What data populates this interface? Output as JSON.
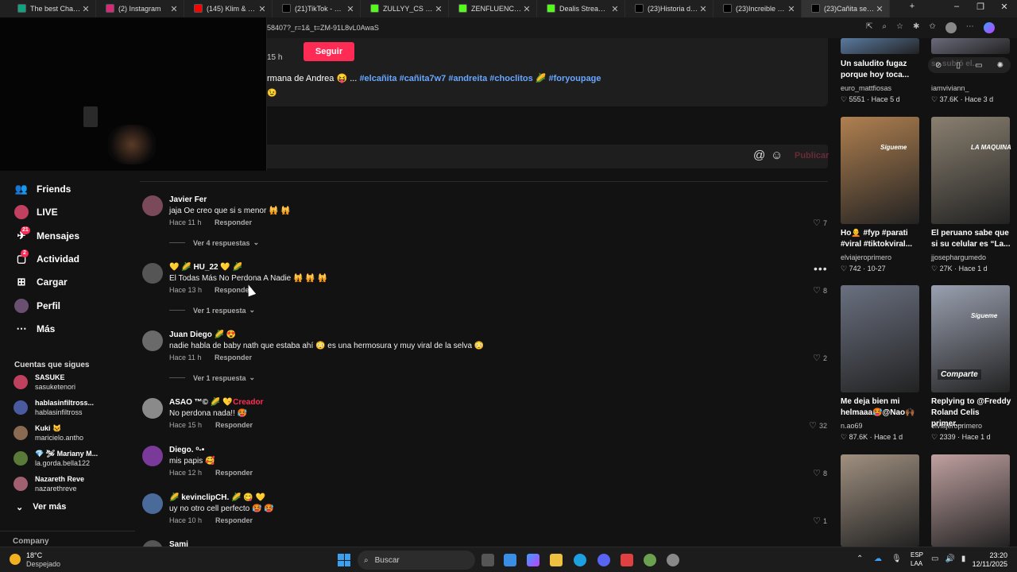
{
  "browser": {
    "tabs": [
      {
        "label": "The best ChatBot ai",
        "icon_color": "#10a37f",
        "icon": "chatbot-icon"
      },
      {
        "label": "(2) Instagram",
        "icon_color": "#d62976",
        "icon": "instagram-icon"
      },
      {
        "label": "(145) Klim & ZULLY",
        "icon_color": "#ff0000",
        "icon": "youtube-icon"
      },
      {
        "label": "(21)TikTok - Make Y",
        "icon_color": "#000000",
        "icon": "tiktok-icon"
      },
      {
        "label": "ZULLYY_CS Stream",
        "icon_color": "#53fc18",
        "icon": "kick-icon"
      },
      {
        "label": "ZENFLUENCER Stre",
        "icon_color": "#53fc18",
        "icon": "kick-icon"
      },
      {
        "label": "Dealis Stream - W",
        "icon_color": "#53fc18",
        "icon": "kick-icon"
      },
      {
        "label": "(23)Historia de Ma",
        "icon_color": "#000000",
        "icon": "tiktok-icon"
      },
      {
        "label": "(23)Increible pero s",
        "icon_color": "#000000",
        "icon": "tiktok-icon"
      },
      {
        "label": "(23)Cañita se encu",
        "icon_color": "#000000",
        "icon": "tiktok-icon",
        "active": true
      }
    ],
    "url": "58407?_r=1&_t=ZM-91L8vL0AwaS"
  },
  "video_panel": {
    "time_fragment": "15 h",
    "follow_label": "Seguir",
    "caption_prefix": "rmana de Andrea 😝 ... ",
    "hashtags": "#elcañita #cañita7w7 #andreita #choclitos 🌽 #foryoupage",
    "second_line": "😉",
    "post_label": "Publicar"
  },
  "sidebar": {
    "items": [
      {
        "label": "Friends",
        "icon": "friends-icon"
      },
      {
        "label": "LIVE",
        "icon": "live-icon"
      },
      {
        "label": "Mensajes",
        "icon": "messages-icon",
        "badge": "21"
      },
      {
        "label": "Actividad",
        "icon": "activity-icon",
        "badge": "2"
      },
      {
        "label": "Cargar",
        "icon": "upload-icon"
      },
      {
        "label": "Perfil",
        "icon": "profile-icon"
      },
      {
        "label": "Más",
        "icon": "more-icon"
      }
    ],
    "following_title": "Cuentas que sigues",
    "following": [
      {
        "name": "SASUKE",
        "handle": "sasuketenori",
        "color": "#c04060"
      },
      {
        "name": "hablasinfiltross...",
        "handle": "hablasinfiltross",
        "color": "#4a5aa0"
      },
      {
        "name": "Kuki 🐱",
        "handle": "maricielo.antho",
        "color": "#8a6a50"
      },
      {
        "name": "💎 🛩 Mariany M...",
        "handle": "la.gorda.bella122",
        "color": "#5a7a3a"
      },
      {
        "name": "Nazareth Reve",
        "handle": "nazarethreve",
        "color": "#a06070"
      }
    ],
    "see_more": "Ver más",
    "company": "Company"
  },
  "comments": [
    {
      "name": "Javier Fer",
      "text": "jaja Oe creo que si s menor 🙀 🙀",
      "time": "Hace 11 h",
      "reply": "Responder",
      "likes": "7",
      "replies": "Ver 4 respuestas",
      "avatar_color": "#7a4a5a"
    },
    {
      "name": "💛 🌽 HU_22 💛 🌽",
      "text": "El Todas Más No Perdona A Nadie 🙀 🙀 🙀",
      "time": "Hace 13 h",
      "reply": "Responder",
      "likes": "8",
      "replies": "Ver 1 respuesta",
      "avatar_color": "#555555"
    },
    {
      "name": "Juan Diego 🌽 😍",
      "text": "nadie habla de baby nath que estaba ahí 😳 es una hermosura y muy viral de la selva 😳",
      "time": "Hace 11 h",
      "reply": "Responder",
      "likes": "2",
      "replies": "Ver 1 respuesta",
      "avatar_color": "#6a6a6a"
    },
    {
      "name": "ASAO ™©  🌽 💛",
      "creator": "· Creador",
      "text": "No perdona nada!! 🥵",
      "time": "Hace 15 h",
      "reply": "Responder",
      "likes": "32",
      "avatar_color": "#8a8a8a"
    },
    {
      "name": "Diego. ᵒ-•",
      "text": "mis papis 🥰",
      "time": "Hace 12 h",
      "reply": "Responder",
      "likes": "8",
      "avatar_color": "#7a3a9a"
    },
    {
      "name": "🌽 kevinclipCH. 🌽 😋 💛",
      "text": "uy no otro cell perfecto 🥵 🥵",
      "time": "Hace 10 h",
      "reply": "Responder",
      "likes": "1",
      "avatar_color": "#4a6a9a"
    },
    {
      "name": "Sami",
      "text": "",
      "time": "",
      "reply": "",
      "likes": "",
      "avatar_color": "#555555"
    }
  ],
  "videos": [
    {
      "title": "Un saludito fugaz porque hoy toca...",
      "user": "euro_mattfiosas",
      "likes": "5551",
      "date": "Hace 5 d",
      "color": "#5a7aa0"
    },
    {
      "title": "se subió el...",
      "user": "iamviviann_",
      "likes": "37.6K",
      "date": "Hace 3 d",
      "color": "#6a6a7a"
    },
    {
      "title": "Ho🧑‍🦲 #fyp #parati #viral #tiktokviral...",
      "user": "elviajeroprimero",
      "likes": "742",
      "date": "10-27",
      "color": "#b08050",
      "tag": "Sígueme"
    },
    {
      "title": "El peruano sabe que si su celular es “La...",
      "user": "jjosephargumedo",
      "likes": "27K",
      "date": "Hace 1 d",
      "color": "#8a8070",
      "tag": "LA MAQUINA"
    },
    {
      "title": "Me deja bien mi helmaaa🥵@Nao🙌🏾",
      "user": "n.ao69",
      "likes": "87.6K",
      "date": "Hace 1 d",
      "color": "#6a7080"
    },
    {
      "title": "Replying to @Freddy Roland Celis primer...",
      "user": "elviajeroprimero",
      "likes": "2339",
      "date": "Hace 1 d",
      "color": "#9aa0b0",
      "tag": "Sígueme",
      "tag2": "Comparte"
    },
    {
      "title": "",
      "user": "",
      "likes": "",
      "date": "",
      "color": "#a09080"
    },
    {
      "title": "",
      "user": "",
      "likes": "",
      "date": "",
      "color": "#c0a0a0"
    }
  ],
  "taskbar": {
    "weather_temp": "18°C",
    "weather_desc": "Despejado",
    "search_placeholder": "Buscar",
    "lang1": "ESP",
    "lang2": "LAA",
    "time": "23:20",
    "date": "12/11/2025"
  }
}
